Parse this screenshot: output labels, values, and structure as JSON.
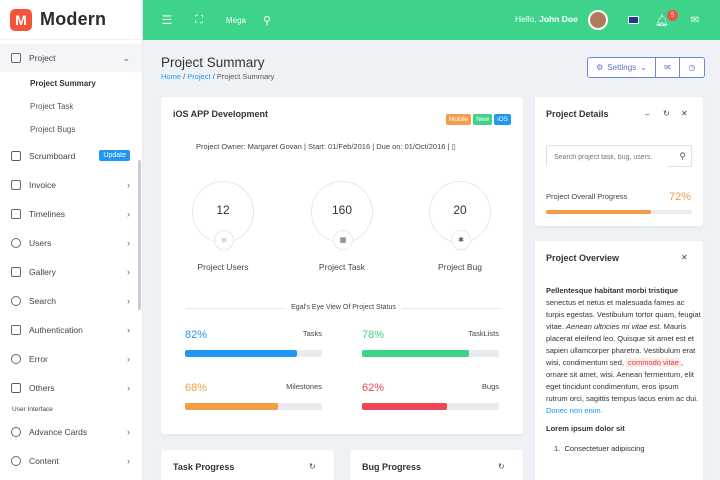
{
  "brand": {
    "logo": "M",
    "name": "Modern"
  },
  "sidebar": {
    "project": {
      "label": "Project",
      "icon": "briefcase-icon"
    },
    "subitems": [
      "Project Summary",
      "Project Task",
      "Project Bugs"
    ],
    "items": [
      {
        "label": "Scrumboard",
        "icon": "check-square-icon",
        "badge": "Update"
      },
      {
        "label": "Invoice",
        "icon": "clipboard-icon"
      },
      {
        "label": "Timelines",
        "icon": "timeline-icon"
      },
      {
        "label": "Users",
        "icon": "user-icon"
      },
      {
        "label": "Gallery",
        "icon": "image-icon"
      },
      {
        "label": "Search",
        "icon": "search-icon"
      },
      {
        "label": "Authentication",
        "icon": "lock-icon"
      },
      {
        "label": "Error",
        "icon": "alert-icon"
      },
      {
        "label": "Others",
        "icon": "clipboard-icon"
      }
    ],
    "section": "User Interface",
    "items2": [
      {
        "label": "Advance Cards",
        "icon": "bulb-icon"
      },
      {
        "label": "Content",
        "icon": "compass-icon"
      }
    ]
  },
  "topbar": {
    "mega": "Mega",
    "hello": "Hello,",
    "user": "John Doe",
    "notif_count": "5"
  },
  "header": {
    "title": "Project Summary",
    "crumbs": [
      "Home",
      "Project",
      "Project Summary"
    ],
    "settings": "Settings"
  },
  "main_card": {
    "title": "iOS APP Development",
    "tags": [
      {
        "label": "Mobile",
        "color": "#f39c4a"
      },
      {
        "label": "New",
        "color": "#3dd38b"
      },
      {
        "label": "iOS",
        "color": "#2196f3"
      }
    ],
    "owner": "Project Owner: Margaret Govan | Start: 01/Feb/2016 | Due on: 01/Oct/2016 |",
    "stats": [
      {
        "value": "12",
        "label": "Project Users"
      },
      {
        "value": "160",
        "label": "Project Task"
      },
      {
        "value": "20",
        "label": "Project Bug"
      }
    ],
    "divider": "Egal's Eye View Of Project Status",
    "progress": [
      {
        "pct": "82%",
        "label": "Tasks",
        "value": 82,
        "color": "#2196f3"
      },
      {
        "pct": "78%",
        "label": "TaskLists",
        "value": 78,
        "color": "#3dd38b"
      },
      {
        "pct": "68%",
        "label": "Milestones",
        "value": 68,
        "color": "#f39c4a"
      },
      {
        "pct": "62%",
        "label": "Bugs",
        "value": 62,
        "color": "#ef4658"
      }
    ]
  },
  "details": {
    "title": "Project Details",
    "search_placeholder": "Search project task, bug, users.",
    "progress_label": "Project Overall Progress",
    "progress_pct": "72%",
    "progress_value": 72
  },
  "overview": {
    "title": "Project Overview",
    "p1_bold": "Pellentesque habitant morbi tristique",
    "p1_a": " senectus et netus et malesuada fames ac turpis egestas. Vestibulum tortor quam, feugiat vitae. ",
    "p1_em": "Aenean ultricies mi vitae est.",
    "p1_b": " Mauris placerat eleifend leo. Quisque sit amet est et sapien ullamcorper pharetra. Vestibulum erat wisi, condimentum sed, ",
    "p1_code": "commodo vitae",
    "p1_c": ", ornare sit amet, wisi. Aenean fermentum, elit eget tincidunt condimentum, eros ipsum rutrum orci, sagittis tempus lacus enim ac dui. ",
    "p1_link": "Donec non enim.",
    "h2": "Lorem ipsum dolor sit",
    "li1": "Consectetuer adipiscing"
  },
  "task_progress": {
    "title": "Task Progress"
  },
  "bug_progress": {
    "title": "Bug Progress"
  }
}
